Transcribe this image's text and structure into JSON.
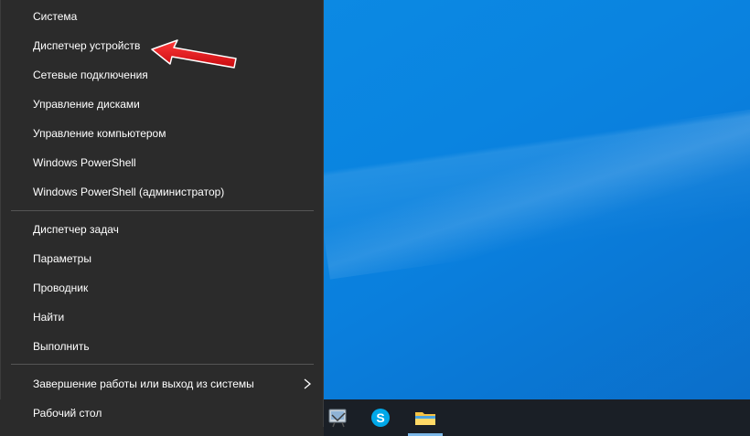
{
  "menu": {
    "items": [
      {
        "label": "Система"
      },
      {
        "label": "Диспетчер устройств"
      },
      {
        "label": "Сетевые подключения"
      },
      {
        "label": "Управление дисками"
      },
      {
        "label": "Управление компьютером"
      },
      {
        "label": "Windows PowerShell"
      },
      {
        "label": "Windows PowerShell (администратор)"
      },
      {
        "label": "Диспетчер задач"
      },
      {
        "label": "Параметры"
      },
      {
        "label": "Проводник"
      },
      {
        "label": "Найти"
      },
      {
        "label": "Выполнить"
      },
      {
        "label": "Завершение работы или выход из системы"
      },
      {
        "label": "Рабочий стол"
      }
    ]
  },
  "taskbar": {
    "icons": [
      "control-panel-icon",
      "skype-icon",
      "file-explorer-icon"
    ]
  },
  "colors": {
    "menu_bg": "#2b2b2b",
    "desktop_blue": "#0a84e0",
    "taskbar_bg": "#1a1f26",
    "arrow_red": "#e8141b"
  }
}
